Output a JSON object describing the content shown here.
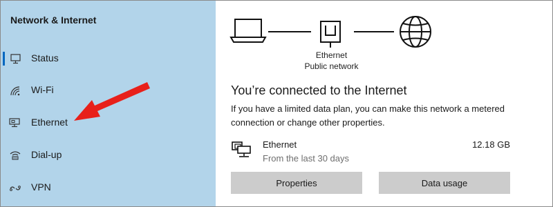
{
  "sidebar": {
    "title": "Network & Internet",
    "items": [
      {
        "label": "Status",
        "icon": "status-icon",
        "selected": true
      },
      {
        "label": "Wi-Fi",
        "icon": "wifi-icon",
        "selected": false
      },
      {
        "label": "Ethernet",
        "icon": "ethernet-icon",
        "selected": false
      },
      {
        "label": "Dial-up",
        "icon": "dialup-icon",
        "selected": false
      },
      {
        "label": "VPN",
        "icon": "vpn-icon",
        "selected": false
      }
    ]
  },
  "diagram": {
    "adapter_name": "Ethernet",
    "network_type": "Public network"
  },
  "main": {
    "headline": "You’re connected to the Internet",
    "description": "If you have a limited data plan, you can make this network a metered connection or change other properties.",
    "connection": {
      "name": "Ethernet",
      "period": "From the last 30 days",
      "usage": "12.18 GB"
    },
    "buttons": {
      "properties": "Properties",
      "data_usage": "Data usage"
    }
  },
  "annotation": {
    "arrow_color": "#e8201a"
  },
  "colors": {
    "sidebar_bg": "#b2d4ea",
    "button_bg": "#cccccc",
    "accent": "#0067c0"
  }
}
